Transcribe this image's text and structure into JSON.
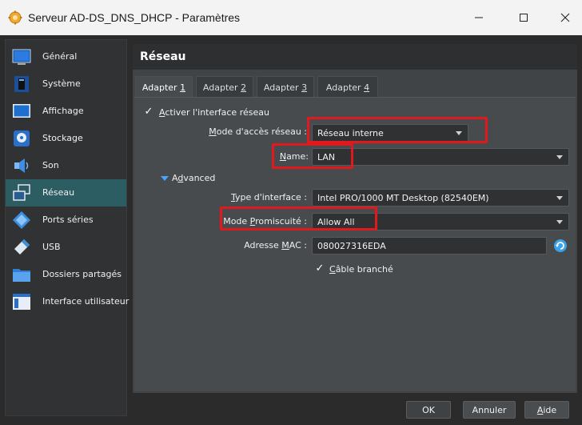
{
  "window": {
    "title": "Serveur AD-DS_DNS_DHCP - Paramètres",
    "controls": {
      "minimize": "—",
      "maximize": "☐",
      "close": "✕"
    }
  },
  "sidebar": {
    "items": [
      {
        "label": "Général",
        "icon": "general-icon"
      },
      {
        "label": "Système",
        "icon": "system-icon"
      },
      {
        "label": "Affichage",
        "icon": "display-icon"
      },
      {
        "label": "Stockage",
        "icon": "storage-icon"
      },
      {
        "label": "Son",
        "icon": "audio-icon"
      },
      {
        "label": "Réseau",
        "icon": "network-icon",
        "active": true
      },
      {
        "label": "Ports séries",
        "icon": "serial-ports-icon"
      },
      {
        "label": "USB",
        "icon": "usb-icon"
      },
      {
        "label": "Dossiers partagés",
        "icon": "shared-folders-icon"
      },
      {
        "label": "Interface utilisateur",
        "icon": "user-interface-icon"
      }
    ]
  },
  "panel": {
    "title": "Réseau",
    "tabs": [
      {
        "prefix": "Adapter ",
        "key": "1",
        "active": true
      },
      {
        "prefix": "Adapter ",
        "key": "2"
      },
      {
        "prefix": "Adapter ",
        "key": "3"
      },
      {
        "prefix": "Adapter ",
        "key": "4"
      }
    ],
    "enable_adapter": {
      "key": "A",
      "rest": "ctiver l'interface réseau",
      "checked": true
    },
    "attached_to": {
      "label_key": "M",
      "label_rest": "ode d'accès réseau :",
      "value": "Réseau interne"
    },
    "name": {
      "label_key": "N",
      "label_rest": "ame:",
      "value": "LAN"
    },
    "advanced": {
      "key": "d",
      "pre": "A",
      "rest": "vanced"
    },
    "adapter_type": {
      "label_key": "T",
      "label_rest": "ype d'interface :",
      "value": "Intel PRO/1000 MT Desktop (82540EM)"
    },
    "promiscuous": {
      "label_pre": "Mode ",
      "label_key": "P",
      "label_rest": "romiscuité :",
      "value": "Allow All"
    },
    "mac": {
      "label_pre": "Adresse ",
      "label_key": "M",
      "label_rest": "AC :",
      "value": "080027316EDA"
    },
    "cable": {
      "key": "C",
      "rest": "âble branché",
      "checked": true
    }
  },
  "footer": {
    "ok": "OK",
    "cancel": "Annuler",
    "help_key": "A",
    "help_rest": "ide"
  },
  "colors": {
    "highlight": "#e0191e",
    "active_sidebar": "#2b5d63",
    "refresh_icon": "#3ba3e8"
  }
}
